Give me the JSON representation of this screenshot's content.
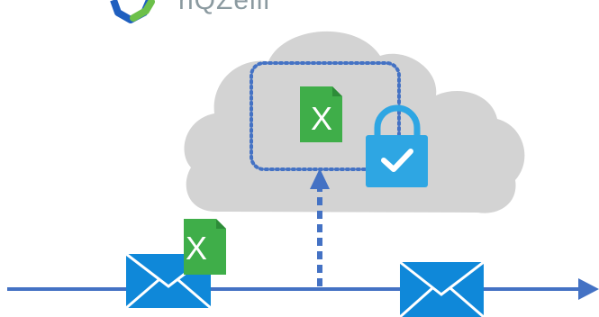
{
  "brand": {
    "name": "nQZeill",
    "logo_icon": "hexagon-logo-icon"
  },
  "cloud": {
    "icon": "cloud-icon",
    "color": "#d3d3d3"
  },
  "secure_zone": {
    "border_color": "#4472c4",
    "border_style": "dotted"
  },
  "files": {
    "cloud_file": {
      "letter": "X",
      "icon": "excel-file-icon",
      "color": "#3fae49"
    },
    "email_file": {
      "letter": "X",
      "icon": "excel-file-icon",
      "color": "#3fae49"
    }
  },
  "lock": {
    "icon": "lock-check-icon",
    "color": "#2ea6e3"
  },
  "envelopes": {
    "icon": "envelope-icon",
    "color": "#0f88d9",
    "count": 2
  },
  "flow": {
    "line_color": "#4472c4",
    "main_arrow": "arrow-right-icon",
    "upload_arrow": "dashed-arrow-up-icon"
  }
}
